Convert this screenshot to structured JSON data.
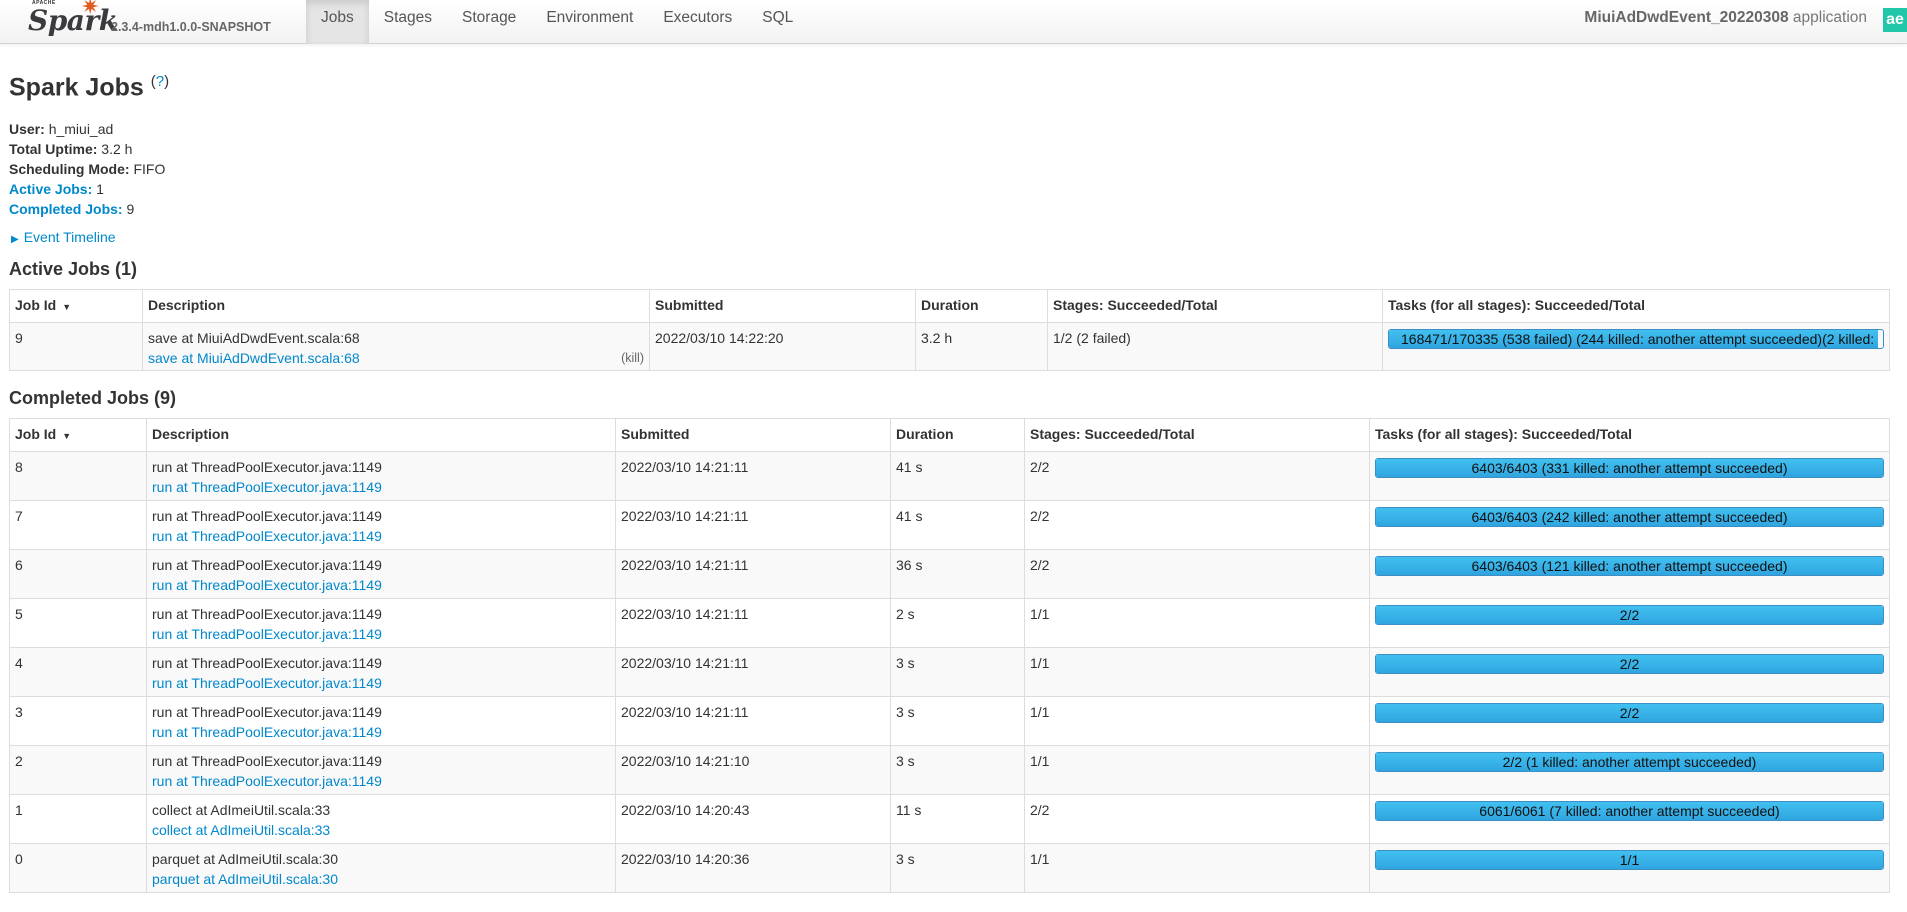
{
  "navbar": {
    "logo_apache": "APACHE",
    "logo_text": "Spark",
    "version": "2.3.4-mdh1.0.0-SNAPSHOT",
    "tabs": [
      {
        "label": "Jobs",
        "active": true
      },
      {
        "label": "Stages",
        "active": false
      },
      {
        "label": "Storage",
        "active": false
      },
      {
        "label": "Environment",
        "active": false
      },
      {
        "label": "Executors",
        "active": false
      },
      {
        "label": "SQL",
        "active": false
      }
    ],
    "app_name": "MiuiAdDwdEvent_20220308",
    "app_suffix": "application",
    "badge": "ae",
    "badge_color": "#21c7a8"
  },
  "page": {
    "title": "Spark Jobs",
    "help_open": "(",
    "help_mark": "?",
    "help_close": ")"
  },
  "summary": {
    "user_label": "User:",
    "user": "h_miui_ad",
    "uptime_label": "Total Uptime:",
    "uptime": "3.2 h",
    "mode_label": "Scheduling Mode:",
    "mode": "FIFO",
    "active_label": "Active Jobs:",
    "active": "1",
    "completed_label": "Completed Jobs:",
    "completed": "9"
  },
  "event_timeline": "Event Timeline",
  "active_jobs": {
    "title": "Active Jobs (1)",
    "headers": [
      "Job Id",
      "Description",
      "Submitted",
      "Duration",
      "Stages: Succeeded/Total",
      "Tasks (for all stages): Succeeded/Total"
    ],
    "rows": [
      {
        "id": "9",
        "desc": "save at MiuiAdDwdEvent.scala:68",
        "desc_link": "save at MiuiAdDwdEvent.scala:68",
        "kill": "(kill)",
        "submitted": "2022/03/10 14:22:20",
        "duration": "3.2 h",
        "stages": "1/2 (2 failed)",
        "tasks": "168471/170335 (538 failed) (244 killed: another attempt succeeded)(2 killed:",
        "progress": 0.989
      }
    ]
  },
  "completed_jobs": {
    "title": "Completed Jobs (9)",
    "headers": [
      "Job Id",
      "Description",
      "Submitted",
      "Duration",
      "Stages: Succeeded/Total",
      "Tasks (for all stages): Succeeded/Total"
    ],
    "rows": [
      {
        "id": "8",
        "desc": "run at ThreadPoolExecutor.java:1149",
        "desc_link": "run at ThreadPoolExecutor.java:1149",
        "submitted": "2022/03/10 14:21:11",
        "duration": "41 s",
        "stages": "2/2",
        "tasks": "6403/6403 (331 killed: another attempt succeeded)",
        "progress": 1
      },
      {
        "id": "7",
        "desc": "run at ThreadPoolExecutor.java:1149",
        "desc_link": "run at ThreadPoolExecutor.java:1149",
        "submitted": "2022/03/10 14:21:11",
        "duration": "41 s",
        "stages": "2/2",
        "tasks": "6403/6403 (242 killed: another attempt succeeded)",
        "progress": 1
      },
      {
        "id": "6",
        "desc": "run at ThreadPoolExecutor.java:1149",
        "desc_link": "run at ThreadPoolExecutor.java:1149",
        "submitted": "2022/03/10 14:21:11",
        "duration": "36 s",
        "stages": "2/2",
        "tasks": "6403/6403 (121 killed: another attempt succeeded)",
        "progress": 1
      },
      {
        "id": "5",
        "desc": "run at ThreadPoolExecutor.java:1149",
        "desc_link": "run at ThreadPoolExecutor.java:1149",
        "submitted": "2022/03/10 14:21:11",
        "duration": "2 s",
        "stages": "1/1",
        "tasks": "2/2",
        "progress": 1
      },
      {
        "id": "4",
        "desc": "run at ThreadPoolExecutor.java:1149",
        "desc_link": "run at ThreadPoolExecutor.java:1149",
        "submitted": "2022/03/10 14:21:11",
        "duration": "3 s",
        "stages": "1/1",
        "tasks": "2/2",
        "progress": 1
      },
      {
        "id": "3",
        "desc": "run at ThreadPoolExecutor.java:1149",
        "desc_link": "run at ThreadPoolExecutor.java:1149",
        "submitted": "2022/03/10 14:21:11",
        "duration": "3 s",
        "stages": "1/1",
        "tasks": "2/2",
        "progress": 1
      },
      {
        "id": "2",
        "desc": "run at ThreadPoolExecutor.java:1149",
        "desc_link": "run at ThreadPoolExecutor.java:1149",
        "submitted": "2022/03/10 14:21:10",
        "duration": "3 s",
        "stages": "1/1",
        "tasks": "2/2 (1 killed: another attempt succeeded)",
        "progress": 1
      },
      {
        "id": "1",
        "desc": "collect at AdImeiUtil.scala:33",
        "desc_link": "collect at AdImeiUtil.scala:33",
        "submitted": "2022/03/10 14:20:43",
        "duration": "11 s",
        "stages": "2/2",
        "tasks": "6061/6061 (7 killed: another attempt succeeded)",
        "progress": 1
      },
      {
        "id": "0",
        "desc": "parquet at AdImeiUtil.scala:30",
        "desc_link": "parquet at AdImeiUtil.scala:30",
        "submitted": "2022/03/10 14:20:36",
        "duration": "3 s",
        "stages": "1/1",
        "tasks": "1/1",
        "progress": 1
      }
    ]
  }
}
